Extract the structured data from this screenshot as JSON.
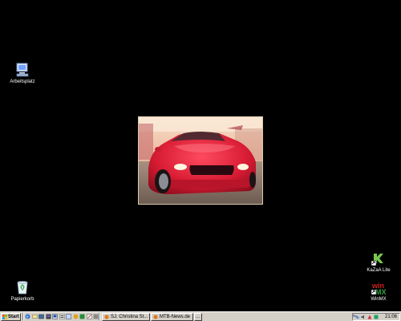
{
  "desktop": {
    "background_color": "#000000",
    "icons": [
      {
        "label": "Arbeitsplatz",
        "icon": "my-computer-icon"
      },
      {
        "label": "Papierkorb",
        "icon": "recycle-bin-icon"
      },
      {
        "label": "KaZaA Lite",
        "icon": "kazaa-lite-icon"
      },
      {
        "label": "WinMX",
        "icon": "winmx-icon"
      }
    ],
    "wallpaper": {
      "subject": "red-sports-car-photo",
      "colors": {
        "car": "#d8203a",
        "sky": "#f0c8b0"
      }
    }
  },
  "taskbar": {
    "start_label": "Start",
    "quick_launch": [
      "internet-explorer-icon",
      "outlook-icon",
      "show-desktop-icon",
      "media-player-icon",
      "explorer-icon",
      "app-icon",
      "app-icon",
      "app-icon",
      "app-icon",
      "app-icon",
      "app-icon"
    ],
    "tasks": [
      {
        "label": "SJ. Christina St...",
        "icon": "browser-window-icon"
      },
      {
        "label": "MTB-News.de",
        "icon": "browser-window-icon"
      },
      {
        "label": "...",
        "icon": ""
      }
    ],
    "tray": {
      "chevron": "«",
      "icons": [
        "network-icon",
        "volume-icon",
        "security-icon",
        "app-tray-icon"
      ],
      "clock": "21:06"
    },
    "colors": {
      "face": "#d4d0c8"
    }
  }
}
